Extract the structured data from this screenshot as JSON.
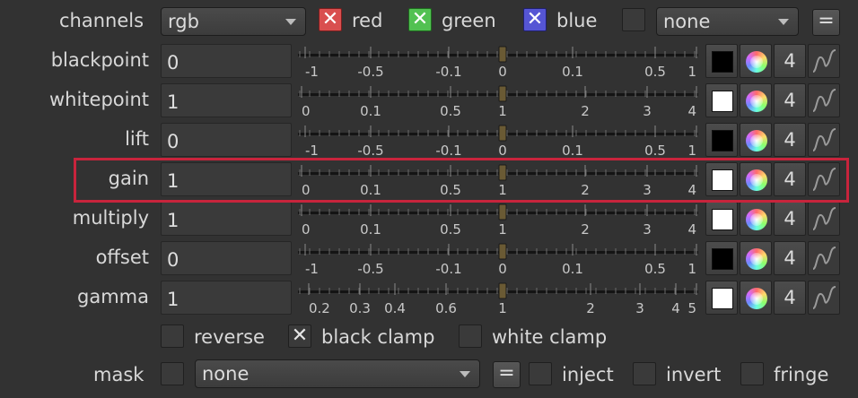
{
  "channels": {
    "label": "channels",
    "value": "rgb",
    "red_label": "red",
    "green_label": "green",
    "blue_label": "blue",
    "extra_value": "none",
    "link_label": "="
  },
  "rows": [
    {
      "label": "blackpoint",
      "value": "0",
      "ticks": [
        "-1",
        "-0.5",
        "-0.1",
        "0",
        "0.1",
        "0.5",
        "1"
      ],
      "slider_value": 0,
      "swatch": "#000000",
      "count": "4"
    },
    {
      "label": "whitepoint",
      "value": "1",
      "ticks": [
        "0",
        "0.1",
        "0.5",
        "1",
        "2",
        "3",
        "4"
      ],
      "slider_value": 1,
      "swatch": "#ffffff",
      "count": "4"
    },
    {
      "label": "lift",
      "value": "0",
      "ticks": [
        "-1",
        "-0.5",
        "-0.1",
        "0",
        "0.1",
        "0.5",
        "1"
      ],
      "slider_value": 0,
      "swatch": "#000000",
      "count": "4"
    },
    {
      "label": "gain",
      "value": "1",
      "ticks": [
        "0",
        "0.1",
        "0.5",
        "1",
        "2",
        "3",
        "4"
      ],
      "slider_value": 1,
      "swatch": "#ffffff",
      "count": "4"
    },
    {
      "label": "multiply",
      "value": "1",
      "ticks": [
        "0",
        "0.1",
        "0.5",
        "1",
        "2",
        "3",
        "4"
      ],
      "slider_value": 1,
      "swatch": "#ffffff",
      "count": "4"
    },
    {
      "label": "offset",
      "value": "0",
      "ticks": [
        "-1",
        "-0.5",
        "-0.1",
        "0",
        "0.1",
        "0.5",
        "1"
      ],
      "slider_value": 0,
      "swatch": "#000000",
      "count": "4"
    },
    {
      "label": "gamma",
      "value": "1",
      "ticks": [
        "0.2",
        "0.3",
        "0.4",
        "0.6",
        "1",
        "2",
        "3",
        "4",
        "5"
      ],
      "slider_value": 1,
      "swatch": "#ffffff",
      "count": "4"
    }
  ],
  "options": {
    "reverse_label": "reverse",
    "black_clamp_label": "black clamp",
    "white_clamp_label": "white clamp"
  },
  "mask": {
    "label": "mask",
    "value": "none",
    "link_label": "=",
    "inject_label": "inject",
    "invert_label": "invert",
    "fringe_label": "fringe"
  },
  "colors": {
    "background": "#323232",
    "selection": "#c8243c",
    "red_check": "#d94f4f",
    "green_check": "#52c152",
    "blue_check": "#5555d4"
  }
}
